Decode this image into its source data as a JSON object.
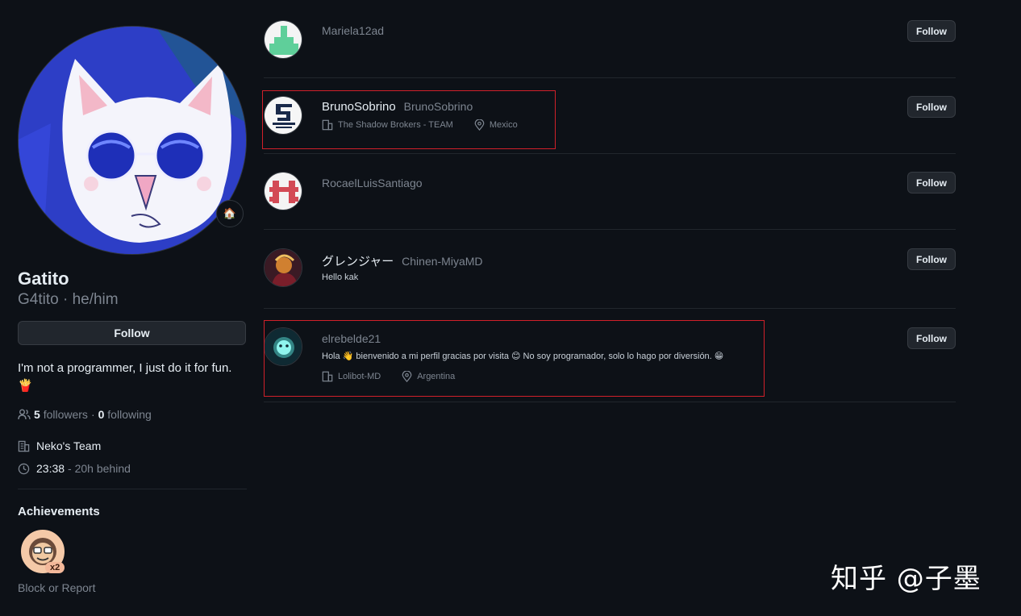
{
  "profile": {
    "name": "Gatito",
    "login_pronouns": "G4tito · he/him",
    "follow_label": "Follow",
    "bio": "I'm not a programmer, I just do it for fun.",
    "bio_emoji": "🍟",
    "followers_count": "5",
    "followers_label": "followers",
    "separator": "·",
    "following_count": "0",
    "following_label": "following",
    "organization": "Neko's Team",
    "local_time": "23:38",
    "time_behind": "- 20h behind",
    "status_emoji": "🏠",
    "achievements_title": "Achievements",
    "achievement_count": "x2",
    "block_report": "Block or Report"
  },
  "users": [
    {
      "display_name": "",
      "login": "Mariela12ad",
      "bio": "",
      "company": "",
      "location": "",
      "follow_label": "Follow",
      "avatar_color": "#ffffff",
      "avatar_accent": "#5fcf9a"
    },
    {
      "display_name": "BrunoSobrino",
      "login": "BrunoSobrino",
      "bio": "",
      "company": "The Shadow Brokers - TEAM",
      "location": "Mexico",
      "follow_label": "Follow",
      "avatar_color": "#ffffff",
      "avatar_accent": "#1a2a4a",
      "avatar_text": "BRUNO SOBRINO"
    },
    {
      "display_name": "",
      "login": "RocaelLuisSantiago",
      "bio": "",
      "company": "",
      "location": "",
      "follow_label": "Follow",
      "avatar_color": "#ffffff",
      "avatar_accent": "#d34a55"
    },
    {
      "display_name": "グレンジャー",
      "login": "Chinen-MiyaMD",
      "bio": "Hello kak",
      "company": "",
      "location": "",
      "follow_label": "Follow",
      "avatar_color": "#3a1a24",
      "avatar_accent": "#d08030"
    },
    {
      "display_name": "",
      "login": "elrebelde21",
      "bio": "Hola 👋 bienvenido a mi perfil gracias por visita 😊 No soy programador, solo lo hago por diversión. 😁",
      "company": "Lolibot-MD",
      "location": "Argentina",
      "follow_label": "Follow",
      "avatar_color": "#0f2a33",
      "avatar_accent": "#58e0d8"
    }
  ],
  "watermark": "知乎 @子墨",
  "colors": {
    "background": "#0d1117",
    "button_bg": "#21262d",
    "muted_text": "#7d8590",
    "highlight_box": "#d0202a"
  }
}
